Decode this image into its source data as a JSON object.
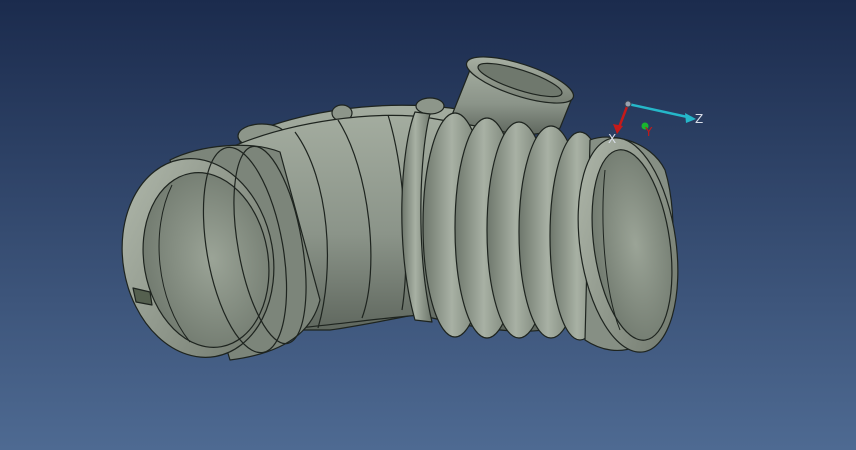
{
  "viewport": {
    "background_top": "#1b2b4d",
    "background_bottom": "#4e6a92",
    "model_color": "#8e978d",
    "model_edge_color": "#1e241f"
  },
  "compass": {
    "x_label": "X",
    "y_label": "Y",
    "z_label": "Z",
    "x_color": "#c41a1a",
    "y_color": "#19b52f",
    "z_color": "#25b7c9",
    "label_color": "#d9dee8"
  }
}
